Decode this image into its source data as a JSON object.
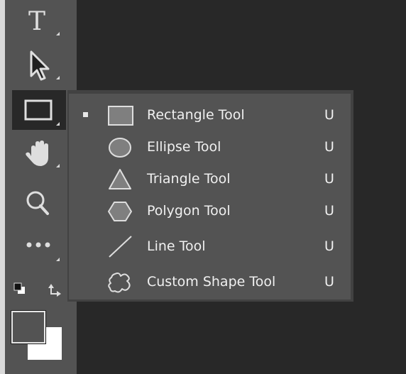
{
  "toolbar": {
    "tools": [
      {
        "name": "type-tool",
        "icon": "type-icon",
        "glyph": "T"
      },
      {
        "name": "path-selection-tool",
        "icon": "arrow-icon"
      },
      {
        "name": "rectangle-tool",
        "icon": "rectangle-icon",
        "active": true
      },
      {
        "name": "hand-tool",
        "icon": "hand-icon"
      },
      {
        "name": "zoom-tool",
        "icon": "zoom-icon"
      },
      {
        "name": "edit-toolbar",
        "icon": "more-icon"
      }
    ],
    "colors": {
      "foreground": "#535353",
      "background": "#ffffff"
    }
  },
  "flyout": {
    "items": [
      {
        "label": "Rectangle Tool",
        "shortcut": "U",
        "icon": "rectangle-icon",
        "selected": true
      },
      {
        "label": "Ellipse Tool",
        "shortcut": "U",
        "icon": "ellipse-icon",
        "selected": false
      },
      {
        "label": "Triangle Tool",
        "shortcut": "U",
        "icon": "triangle-icon",
        "selected": false
      },
      {
        "label": "Polygon Tool",
        "shortcut": "U",
        "icon": "polygon-icon",
        "selected": false
      },
      {
        "label": "Line Tool",
        "shortcut": "U",
        "icon": "line-icon",
        "selected": false
      },
      {
        "label": "Custom Shape Tool",
        "shortcut": "U",
        "icon": "custom-shape-icon",
        "selected": false
      }
    ]
  }
}
